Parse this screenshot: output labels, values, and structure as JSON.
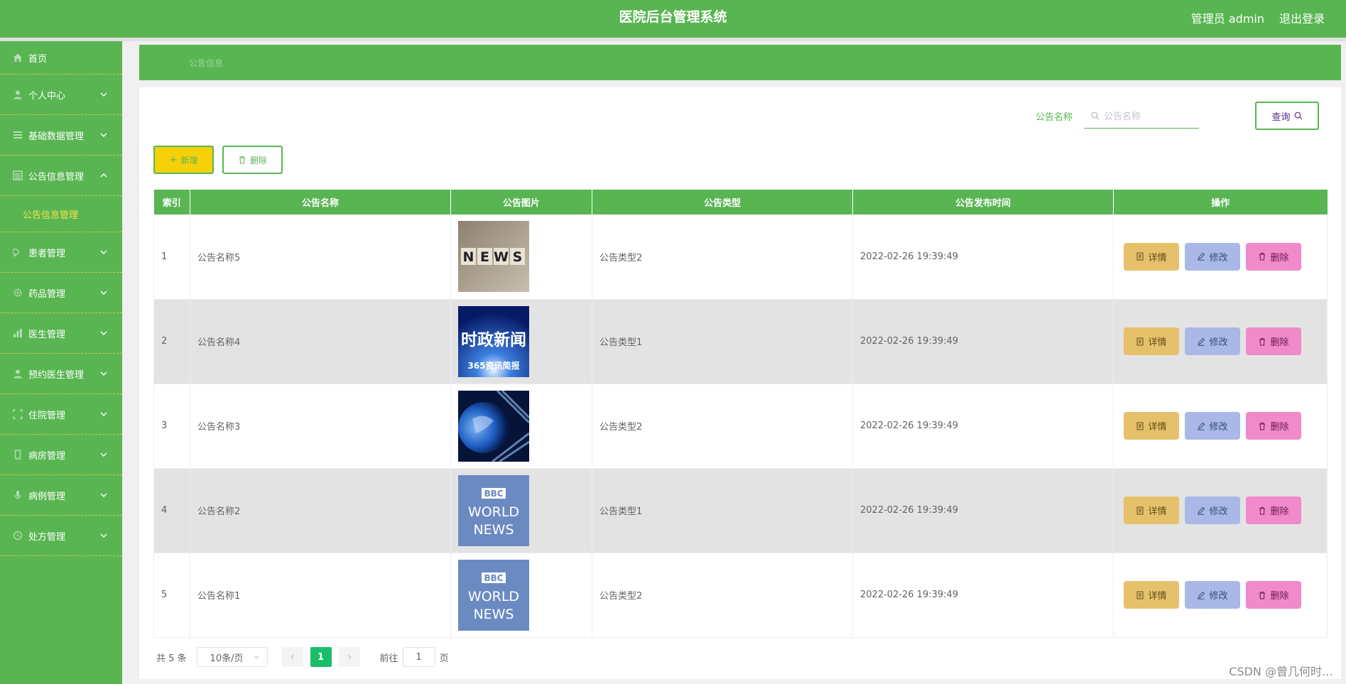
{
  "header": {
    "title": "医院后台管理系统",
    "user": "管理员 admin",
    "logout": "退出登录"
  },
  "sidebar": {
    "items": [
      {
        "label": "首页",
        "icon": "home-icon"
      },
      {
        "label": "个人中心",
        "icon": "user-icon"
      },
      {
        "label": "基础数据管理",
        "icon": "grid-icon"
      },
      {
        "label": "公告信息管理",
        "icon": "grid-icon",
        "sub": "公告信息管理"
      },
      {
        "label": "患者管理",
        "icon": "chat-icon"
      },
      {
        "label": "药品管理",
        "icon": "gear-icon"
      },
      {
        "label": "医生管理",
        "icon": "chart-icon"
      },
      {
        "label": "预约医生管理",
        "icon": "user-icon"
      },
      {
        "label": "住院管理",
        "icon": "frame-icon"
      },
      {
        "label": "病房管理",
        "icon": "phone-icon"
      },
      {
        "label": "病例管理",
        "icon": "mic-icon"
      },
      {
        "label": "处方管理",
        "icon": "clock-icon"
      }
    ]
  },
  "breadcrumb": "公告信息",
  "search": {
    "label": "公告名称",
    "placeholder": "公告名称",
    "button": "查询"
  },
  "toolbar": {
    "add": "新增",
    "delete": "删除"
  },
  "table": {
    "headers": [
      "索引",
      "公告名称",
      "公告图片",
      "公告类型",
      "公告发布时间",
      "操作"
    ],
    "rows": [
      {
        "index": "1",
        "name": "公告名称5",
        "image": "news-cubes",
        "type": "公告类型2",
        "time": "2022-02-26 19:39:49"
      },
      {
        "index": "2",
        "name": "公告名称4",
        "image": "shizheng-news",
        "type": "公告类型1",
        "time": "2022-02-26 19:39:49"
      },
      {
        "index": "3",
        "name": "公告名称3",
        "image": "globe-news",
        "type": "公告类型2",
        "time": "2022-02-26 19:39:49"
      },
      {
        "index": "4",
        "name": "公告名称2",
        "image": "bbc-news",
        "type": "公告类型1",
        "time": "2022-02-26 19:39:49"
      },
      {
        "index": "5",
        "name": "公告名称1",
        "image": "bbc-news",
        "type": "公告类型2",
        "time": "2022-02-26 19:39:49"
      }
    ],
    "actions": {
      "detail": "详情",
      "edit": "修改",
      "delete": "删除"
    }
  },
  "thumb_text": {
    "news": [
      "N",
      "E",
      "W",
      "S"
    ],
    "shizheng_title": "时政新闻",
    "shizheng_sub": "365资讯简报",
    "bbc": [
      "BBC",
      "WORLD",
      "NEWS"
    ]
  },
  "pager": {
    "total": "共 5 条",
    "size": "10条/页",
    "page": "1",
    "goto_prefix": "前往",
    "goto_value": "1",
    "goto_suffix": "页"
  },
  "watermark": "CSDN @曾几何时…",
  "colors": {
    "primary": "#58b552",
    "menu_active": "#f6e24a",
    "add_button": "#f5d10a",
    "detail": "#e6c16b",
    "edit": "#aab8e8",
    "delete": "#f08ac8",
    "page_active": "#19be6b"
  }
}
